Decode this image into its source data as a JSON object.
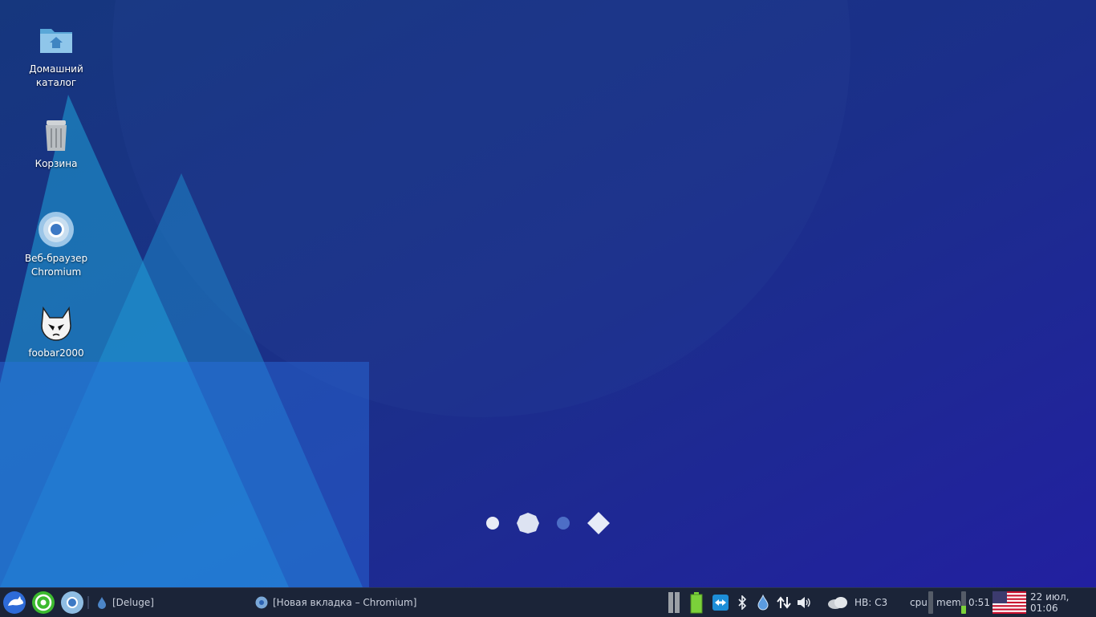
{
  "desktop": {
    "icons": [
      {
        "label": "Домашний каталог",
        "icon": "home-folder-icon"
      },
      {
        "label": "Корзина",
        "icon": "trash-icon"
      },
      {
        "label": "Веб-браузер Chromium",
        "icon": "chromium-icon"
      },
      {
        "label": "foobar2000",
        "icon": "foobar2000-icon"
      }
    ]
  },
  "panel": {
    "launchers": [
      {
        "name": "whisker-menu",
        "icon": "xfce-mouse-icon"
      },
      {
        "name": "whatsapp",
        "icon": "whatsapp-icon"
      },
      {
        "name": "chromium",
        "icon": "chromium-icon"
      }
    ],
    "tasks": [
      {
        "label": "[Deluge]",
        "icon": "deluge-icon"
      },
      {
        "label": "[Новая вкладка – Chromium]",
        "icon": "chromium-icon"
      }
    ],
    "tray": {
      "weather_text": "НВ: C3",
      "cpu_label": "cpu",
      "mem_label": "mem",
      "battery_time": "0:51",
      "keyboard_layout": "us-flag-icon",
      "clock": "22 июл, 01:06"
    },
    "meters": {
      "cpu": 0.0,
      "mem": 0.35
    }
  },
  "colors": {
    "panel_bg": "#1b2438",
    "accent": "#2a6fd6",
    "battery_green": "#7bd13a"
  }
}
